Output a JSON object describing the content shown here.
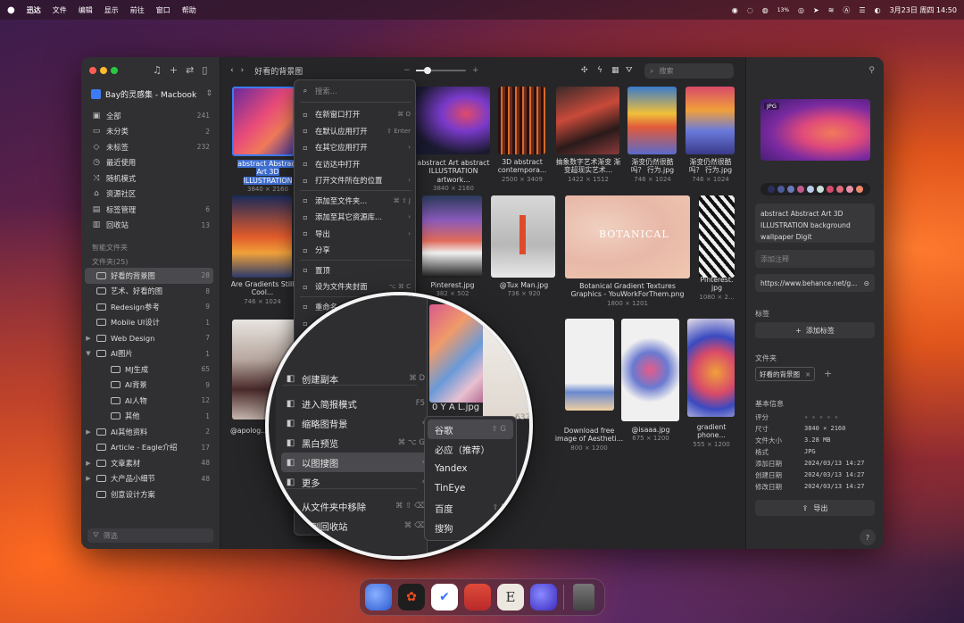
{
  "menubar": {
    "app": "迅达",
    "items": [
      "文件",
      "编辑",
      "显示",
      "前往",
      "窗口",
      "帮助"
    ],
    "battery": "13%",
    "datetime": "3月23日 周四  14:50"
  },
  "sidebar": {
    "library": "Bay的灵感集 - Macbook",
    "nav": [
      {
        "icon": "all-icon",
        "label": "全部",
        "count": "241"
      },
      {
        "icon": "inbox-icon",
        "label": "未分类",
        "count": "2"
      },
      {
        "icon": "tag-icon",
        "label": "未标签",
        "count": "232"
      },
      {
        "icon": "clock-icon",
        "label": "最近使用",
        "count": ""
      },
      {
        "icon": "shuffle-icon",
        "label": "随机模式",
        "count": ""
      },
      {
        "icon": "community-icon",
        "label": "资源社区",
        "count": ""
      },
      {
        "icon": "tag-manage-icon",
        "label": "标签管理",
        "count": "6"
      },
      {
        "icon": "trash-icon",
        "label": "回收站",
        "count": "13"
      }
    ],
    "smart_folders": "智能文件夹",
    "folders_header": "文件夹(25)",
    "folders": [
      {
        "label": "好看的背景图",
        "count": "28",
        "indent": 0,
        "arrow": "",
        "selected": true
      },
      {
        "label": "艺术、好看的图",
        "count": "8",
        "indent": 0,
        "arrow": ""
      },
      {
        "label": "Redesign参考",
        "count": "9",
        "indent": 0,
        "arrow": ""
      },
      {
        "label": "Mobile UI设计",
        "count": "1",
        "indent": 0,
        "arrow": ""
      },
      {
        "label": "Web Design",
        "count": "7",
        "indent": 0,
        "arrow": "▶"
      },
      {
        "label": "AI图片",
        "count": "1",
        "indent": 0,
        "arrow": "▼"
      },
      {
        "label": "MJ生成",
        "count": "65",
        "indent": 1,
        "arrow": ""
      },
      {
        "label": "AI背景",
        "count": "9",
        "indent": 1,
        "arrow": ""
      },
      {
        "label": "AI人物",
        "count": "12",
        "indent": 1,
        "arrow": ""
      },
      {
        "label": "其他",
        "count": "1",
        "indent": 1,
        "arrow": ""
      },
      {
        "label": "AI其他资料",
        "count": "2",
        "indent": 0,
        "arrow": "▶"
      },
      {
        "label": "Article - Eagle介绍",
        "count": "17",
        "indent": 0,
        "arrow": ""
      },
      {
        "label": "文章素材",
        "count": "48",
        "indent": 0,
        "arrow": "▶"
      },
      {
        "label": "大产品小细节",
        "count": "48",
        "indent": 0,
        "arrow": "▶"
      },
      {
        "label": "创意设计方案",
        "count": "",
        "indent": 0,
        "arrow": ""
      }
    ],
    "filter_placeholder": "筛选"
  },
  "toolbar": {
    "title": "好看的背景图",
    "search_placeholder": "搜索"
  },
  "grid": [
    {
      "name": "abstract Abstract Art 3D ILLUSTRATION",
      "dim": "3840 × 2160",
      "selected": true
    },
    {
      "name": "abstract Art abstract ILLUSTRATION artwork...",
      "dim": "3840 × 2160"
    },
    {
      "name": "3D abstract contempora...",
      "dim": "2500 × 3409"
    },
    {
      "name": "抽象数字艺术渐变 渐变超现实艺术...",
      "dim": "1422 × 1512"
    },
    {
      "name": "渐变仍然很酷吗？ 行为.jpg",
      "dim": "746 × 1024"
    },
    {
      "name": "渐变仍然很酷吗？ 行为.jpg",
      "dim": "746 × 1024"
    },
    {
      "name": "Are Gradients Still Cool...",
      "dim": "746 × 1024"
    },
    {
      "name": "Pinterest.jpg",
      "dim": "382 × 502"
    },
    {
      "name": "@Tux Man.jpg",
      "dim": "736 × 920"
    },
    {
      "name": "Botanical Gradient Textures Graphics - YouWorkForThem.png",
      "dim": "1800 × 1201"
    },
    {
      "name": "Pinterest. jpg",
      "dim": "1080 × 2..."
    },
    {
      "name": "@apolog...",
      "dim": ""
    },
    {
      "name": "0 Y A L.jpg",
      "dim": ""
    },
    {
      "name": "@P...",
      "dim": "637..."
    },
    {
      "name": "Download free image of Aestheti...",
      "dim": "800 × 1200"
    },
    {
      "name": "@isaaa.jpg",
      "dim": "675 × 1200"
    },
    {
      "name": "gradient phone...",
      "dim": "555 × 1200"
    }
  ],
  "botanical_text": "BOTANICAL",
  "context_menu": {
    "search_placeholder": "搜索...",
    "items": [
      {
        "icon": "new-window-icon",
        "label": "在新窗口打开",
        "shortcut": "⌘ O"
      },
      {
        "icon": "default-app-icon",
        "label": "在默认应用打开",
        "shortcut": "⇧ Enter"
      },
      {
        "icon": "other-app-icon",
        "label": "在其它应用打开",
        "shortcut": "›"
      },
      {
        "icon": "finder-icon",
        "label": "在访达中打开",
        "shortcut": ""
      },
      {
        "icon": "folder-open-icon",
        "label": "打开文件所在的位置",
        "shortcut": "›"
      },
      {
        "icon": "add-folder-icon",
        "label": "添加至文件夹...",
        "shortcut": "⌘ ⇧ J"
      },
      {
        "icon": "add-library-icon",
        "label": "添加至其它资源库...",
        "shortcut": "›"
      },
      {
        "icon": "export-icon",
        "label": "导出",
        "shortcut": "›"
      },
      {
        "icon": "share-icon",
        "label": "分享",
        "shortcut": ""
      },
      {
        "icon": "pin-icon",
        "label": "置顶",
        "shortcut": ""
      },
      {
        "icon": "cover-icon",
        "label": "设为文件夹封面",
        "shortcut": "⌥ ⌘ C"
      },
      {
        "icon": "rename-icon",
        "label": "重命名",
        "shortcut": "›"
      },
      {
        "icon": "copy-icon",
        "label": "复...",
        "shortcut": ""
      },
      {
        "icon": "copy-tag-icon",
        "label": "...制标签",
        "shortcut": "⌘ ⇧ C"
      },
      {
        "icon": "paste-tag-icon",
        "label": "粘贴标签",
        "shortcut": "⌘ ⇧ V"
      }
    ]
  },
  "lens_menu": {
    "items": [
      {
        "icon": "duplicate-icon",
        "label": "创建副本",
        "shortcut": "⌘ D"
      },
      {
        "icon": "present-icon",
        "label": "进入简报模式",
        "shortcut": "F5"
      },
      {
        "icon": "thumbnail-bg-icon",
        "label": "缩略图背景",
        "shortcut": "›"
      },
      {
        "icon": "grayscale-icon",
        "label": "黑白预览",
        "shortcut": "⌘ ⌥ G"
      },
      {
        "icon": "image-search-icon",
        "label": "以图搜图",
        "shortcut": "›",
        "selected": true
      },
      {
        "icon": "more-icon",
        "label": "更多",
        "shortcut": "›"
      },
      {
        "icon": "remove-folder-icon",
        "label": "从文件夹中移除",
        "shortcut": "⌘ ⇧ ⌫"
      },
      {
        "icon": "trash-icon",
        "label": "丢到回收站",
        "shortcut": "⌘ ⌫"
      }
    ],
    "submenu": [
      {
        "label": "谷歌",
        "shortcut": "⇧ G",
        "selected": true
      },
      {
        "label": "必应（推荐）",
        "shortcut": ""
      },
      {
        "label": "Yandex",
        "shortcut": ""
      },
      {
        "label": "TinEye",
        "shortcut": ""
      },
      {
        "label": "百度",
        "shortcut": "⇧ B"
      },
      {
        "label": "搜狗",
        "shortcut": ""
      }
    ]
  },
  "inspector": {
    "badge": "JPG",
    "palette": [
      "#2a2f5a",
      "#4a5a9a",
      "#6a78b8",
      "#c05a8a",
      "#b8c8e8",
      "#c8e0d8",
      "#d84a6a",
      "#e06a7a",
      "#e890a8",
      "#f08a6a"
    ],
    "title": "abstract Abstract Art 3D ILLUSTRATION  background wallpaper Digit",
    "note_placeholder": "添加注释",
    "url": "https://www.behance.net/g...",
    "tags_label": "标签",
    "add_tag": "添加标签",
    "folder_label": "文件夹",
    "folder_chip": "好看的背景图",
    "basic_label": "基本信息",
    "props": [
      {
        "k": "评分",
        "v": "★ ★ ★ ★ ★"
      },
      {
        "k": "尺寸",
        "v": "3840 × 2160"
      },
      {
        "k": "文件大小",
        "v": "3.28 MB"
      },
      {
        "k": "格式",
        "v": "JPG"
      },
      {
        "k": "添加日期",
        "v": "2024/03/13 14:27"
      },
      {
        "k": "创建日期",
        "v": "2024/03/13 14:27"
      },
      {
        "k": "修改日期",
        "v": "2024/03/13 14:27"
      }
    ],
    "export": "导出",
    "help": "?"
  }
}
